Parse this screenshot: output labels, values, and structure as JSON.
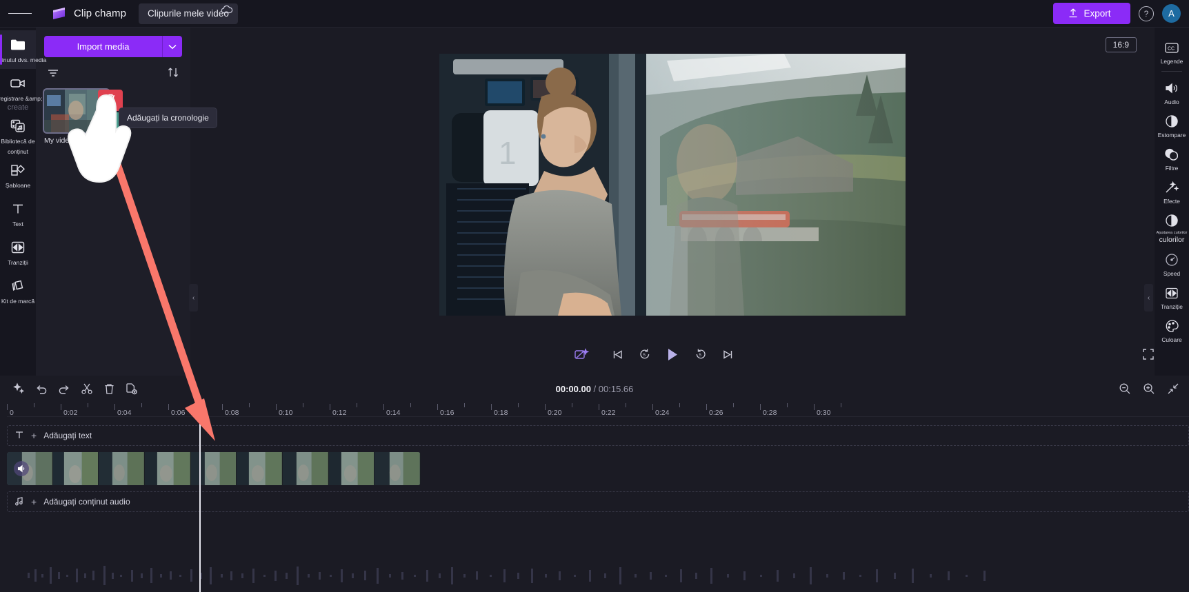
{
  "app": {
    "brand_name": "Clip champ",
    "project_tab": "Clipurile mele video",
    "menu_icon": "hamburger-icon",
    "cloud_icon": "cloud-sync-icon"
  },
  "topbar": {
    "export_label": "Export",
    "export_icon": "upload-icon",
    "help_icon": "help-circle-icon",
    "avatar_initial": "A",
    "accent_color": "#8b2bf7"
  },
  "left_rail": {
    "items": [
      {
        "label": "Conținutul dvs. media",
        "icon": "folder-icon",
        "active": true
      },
      {
        "label": "Înregistrare &amp;",
        "label2": "create",
        "icon": "video-camera-icon",
        "active": false
      },
      {
        "label": "Bibliotecă de",
        "label2": "conținut",
        "icon": "content-library-icon",
        "active": false
      },
      {
        "label": "Șabloane",
        "icon": "templates-icon",
        "active": false
      },
      {
        "label": "Text",
        "icon": "text-icon",
        "active": false
      },
      {
        "label": "Tranziții",
        "icon": "transitions-icon",
        "active": false
      },
      {
        "label": "Kit de marcă",
        "icon": "brand-kit-icon",
        "active": false
      }
    ]
  },
  "media_panel": {
    "import_label": "Import media",
    "import_caret_icon": "chevron-down-icon",
    "filter_icon": "filter-icon",
    "sort_icon": "sort-arrows-icon",
    "items": [
      {
        "name": "My video.mp4",
        "delete_icon": "trash-icon",
        "add_icon": "plus-icon",
        "tooltip": "Adăugați la cronologie"
      }
    ]
  },
  "preview": {
    "aspect_ratio": "16:9",
    "autofix_icon": "magic-autofix-icon",
    "fullscreen_icon": "fullscreen-icon",
    "controls": [
      {
        "name": "skip-to-start",
        "icon": "skip-start-icon"
      },
      {
        "name": "rewind-5-seconds",
        "icon": "rewind-5-icon"
      },
      {
        "name": "play",
        "icon": "play-icon"
      },
      {
        "name": "forward-5-seconds",
        "icon": "forward-5-icon"
      },
      {
        "name": "skip-to-end",
        "icon": "skip-end-icon"
      }
    ]
  },
  "right_rail": {
    "items": [
      {
        "label": "Legende",
        "icon": "closed-captions-icon"
      },
      {
        "label": "Audio",
        "icon": "speaker-icon"
      },
      {
        "label": "Estompare",
        "icon": "fade-icon"
      },
      {
        "label": "Filtre",
        "icon": "filters-icon"
      },
      {
        "label": "Efecte",
        "icon": "effects-wand-icon"
      },
      {
        "label": "Ajustarea culorilor",
        "label_big": "culorilor",
        "icon": "color-adjust-icon"
      },
      {
        "label": "Speed",
        "icon": "speedometer-icon"
      },
      {
        "label": "Tranziție",
        "icon": "transitions-icon"
      },
      {
        "label": "Culoare",
        "icon": "palette-icon"
      }
    ]
  },
  "timeline": {
    "tools": [
      {
        "name": "auto-compose",
        "icon": "sparkle-icon"
      },
      {
        "name": "undo",
        "icon": "undo-icon"
      },
      {
        "name": "redo",
        "icon": "redo-icon"
      },
      {
        "name": "split",
        "icon": "scissors-icon"
      },
      {
        "name": "delete",
        "icon": "trash-icon"
      },
      {
        "name": "duplicate",
        "icon": "duplicate-icon"
      }
    ],
    "current_time": "00:00.00",
    "separator": " / ",
    "total_time": "00:15.66",
    "zoom_out_icon": "zoom-out-icon",
    "zoom_in_icon": "zoom-in-icon",
    "fit_icon": "fit-to-screen-icon",
    "ruler_labels": [
      "0",
      "0:02",
      "0:04",
      "0:06",
      "0:08",
      "0:10",
      "0:12",
      "0:14",
      "0:16",
      "0:18",
      "0:20",
      "0:22",
      "0:24",
      "0:26",
      "0:28",
      "0:30"
    ],
    "tracks": [
      {
        "type": "text",
        "label": "Adăugați text",
        "icon": "text-icon",
        "plus": "+"
      },
      {
        "type": "video",
        "label": "",
        "icon": "speaker-icon"
      },
      {
        "type": "audio",
        "label": "Adăugați conținut audio",
        "icon": "music-note-icon",
        "plus": "+"
      }
    ]
  },
  "annotation": {
    "arrow_color": "#f9776b",
    "cursor_icon": "hand-pointer-icon"
  }
}
